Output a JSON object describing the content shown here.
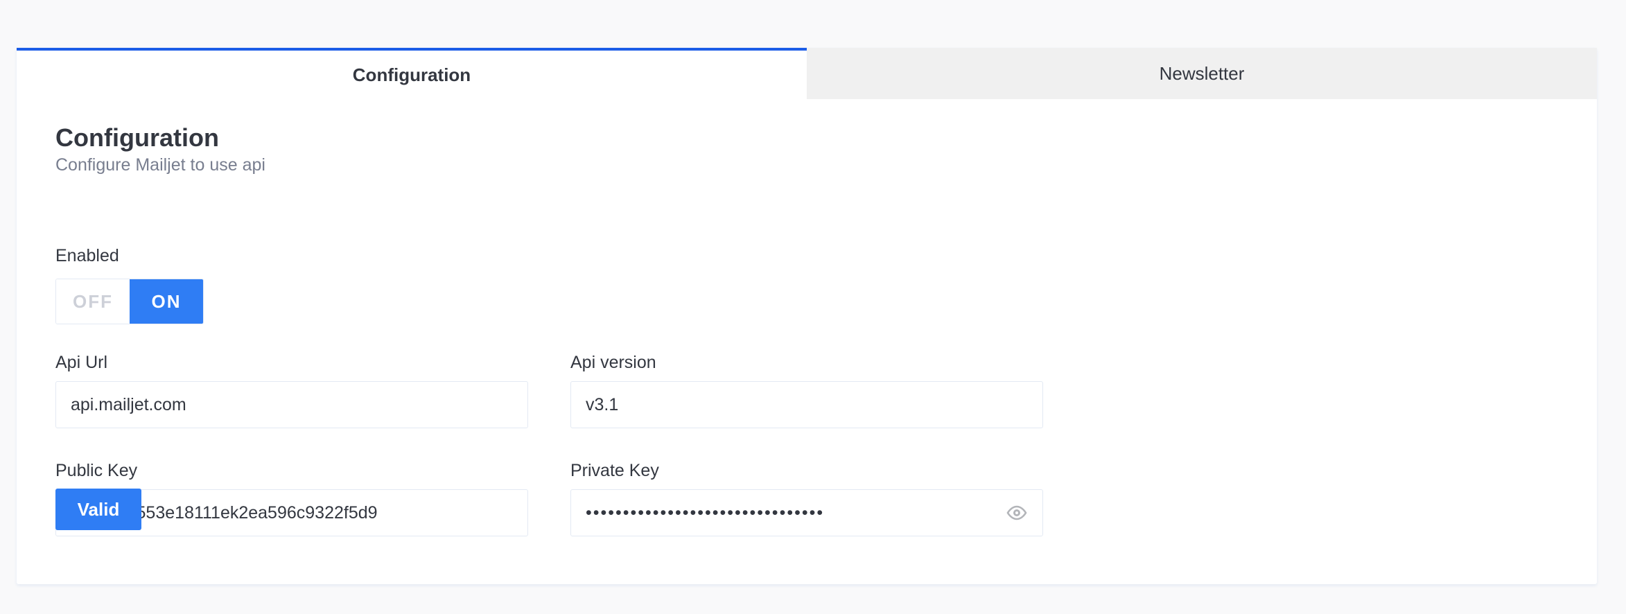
{
  "tabs": [
    {
      "label": "Configuration",
      "active": true
    },
    {
      "label": "Newsletter",
      "active": false
    }
  ],
  "section": {
    "title": "Configuration",
    "subtitle": "Configure Mailjet to use api"
  },
  "enabled": {
    "label": "Enabled",
    "off_label": "OFF",
    "on_label": "ON",
    "value": "ON"
  },
  "fields": {
    "api_url": {
      "label": "Api Url",
      "value": "api.mailjet.com"
    },
    "api_version": {
      "label": "Api version",
      "value": "v3.1"
    },
    "public_key": {
      "label": "Public Key",
      "value": "76879cc553e18111ek2ea596c9322f5d9"
    },
    "private_key": {
      "label": "Private Key",
      "value": "••••••••••••••••••••••••••••••••"
    }
  },
  "actions": {
    "valid_label": "Valid"
  },
  "colors": {
    "accent": "#2f7df4",
    "active_tab_border": "#1c5de7",
    "inactive_tab_bg": "#f0f0f0"
  },
  "icons": {
    "private_key_toggle": "eye-icon"
  }
}
